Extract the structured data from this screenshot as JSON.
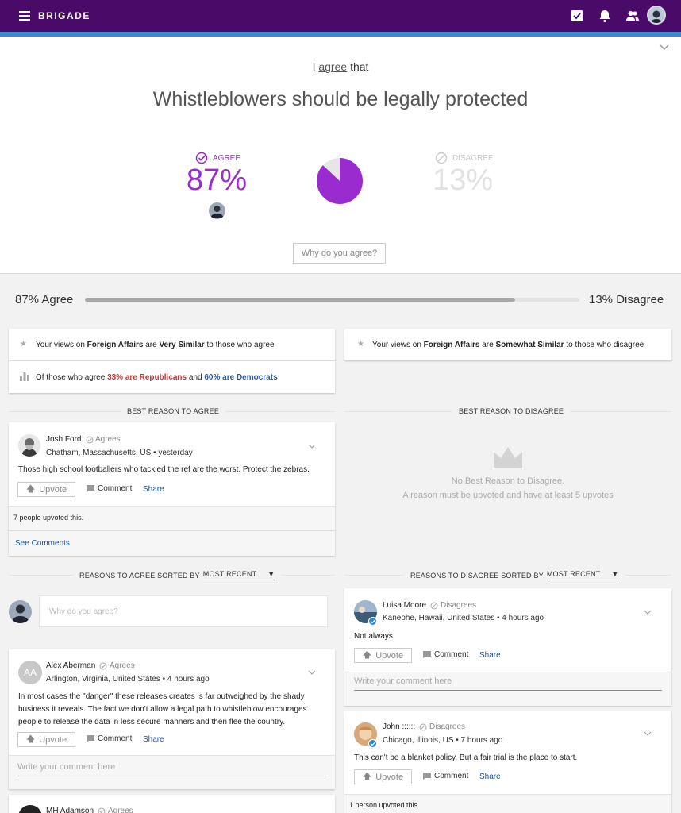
{
  "topbar": {
    "brand": "BRIGADE"
  },
  "hero": {
    "prefix": "I",
    "stance": "agree",
    "suffix": "that",
    "title": "Whistleblowers should be legally protected",
    "agree_label": "AGREE",
    "agree_pct": "87%",
    "disagree_label": "DISAGREE",
    "disagree_pct": "13%",
    "agree_fraction": 0.87,
    "why_button": "Why do you agree?"
  },
  "bar": {
    "agree_label": "87% Agree",
    "disagree_label": "13% Disagree",
    "agree_fraction": 0.87
  },
  "similarity": {
    "left": {
      "pre": "Your views on",
      "topic": "Foreign Affairs",
      "mid": "are",
      "level": "Very Similar",
      "post": "to those who agree"
    },
    "right": {
      "pre": "Your views on",
      "topic": "Foreign Affairs",
      "mid": "are",
      "level": "Somewhat Similar",
      "post": "to those who disagree"
    },
    "party": {
      "pre": "Of those who agree",
      "rep": "33% are Republicans",
      "and": "and",
      "dem": "60% are Democrats"
    }
  },
  "best_agree": {
    "header": "BEST REASON TO AGREE",
    "name": "Josh Ford",
    "stance": "Agrees",
    "location": "Chatham, Massachusetts, US",
    "time": "yesterday",
    "text": "Those high school footballers who tackled the ref are the worst. Protect the zebras.",
    "upvote": "Upvote",
    "comment": "Comment",
    "share": "Share",
    "upvoted": "7 people upvoted this.",
    "see_comments": "See Comments"
  },
  "best_disagree": {
    "header": "BEST REASON TO DISAGREE",
    "empty_title": "No Best Reason to Disagree.",
    "empty_desc": "A reason must be upvoted and have at least 5 upvotes"
  },
  "agree_list": {
    "header_pre": "REASONS TO AGREE SORTED BY",
    "sort": "MOST RECENT",
    "input_placeholder": "Why do you agree?",
    "items": [
      {
        "initials": "AA",
        "name": "Alex Aberman",
        "stance": "Agrees",
        "location": "Arlington, Virginia, United States",
        "time": "4 hours ago",
        "text": [
          "In most cases the \"danger\" these releases creates is far outweighed by the shady",
          "business it reveals. The fact we don't allow a legal path to whistleblow encourages",
          "people to release the data in less secure manners and then flee the country."
        ],
        "upvote": "Upvote",
        "comment": "Comment",
        "share": "Share",
        "comment_placeholder": "Write your comment here"
      },
      {
        "name": "MH Adamson",
        "stance": "Agrees"
      }
    ]
  },
  "disagree_list": {
    "header_pre": "REASONS TO DISAGREE SORTED BY",
    "sort": "MOST RECENT",
    "items": [
      {
        "name": "Luisa Moore",
        "stance": "Disagrees",
        "location": "Kaneohe, Hawaii, United States",
        "time": "4 hours ago",
        "text": "Not always",
        "upvote": "Upvote",
        "comment": "Comment",
        "share": "Share",
        "comment_placeholder": "Write your comment here"
      },
      {
        "name": "John ::::::",
        "stance": "Disagrees",
        "location": "Chicago, Illinois, US",
        "time": "7 hours ago",
        "text": "This can't be a blanket policy. But a fair trial is the place to start.",
        "upvote": "Upvote",
        "comment": "Comment",
        "share": "Share",
        "upvoted": "1 person upvoted this."
      }
    ]
  },
  "colors": {
    "purple": "#9a2ccf",
    "topbar": "#4a0a68",
    "blue": "#3f88cf",
    "rep": "#d0312d",
    "dem": "#2b5aa8"
  }
}
